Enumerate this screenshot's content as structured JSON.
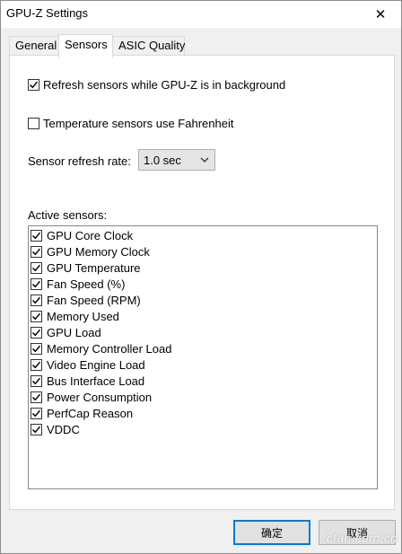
{
  "window": {
    "title": "GPU-Z Settings",
    "close_glyph": "✕"
  },
  "tabs": [
    {
      "label": "General",
      "active": false
    },
    {
      "label": "Sensors",
      "active": true
    },
    {
      "label": "ASIC Quality",
      "active": false
    }
  ],
  "options": {
    "refresh_background": {
      "label": "Refresh sensors while GPU-Z is in background",
      "checked": true
    },
    "fahrenheit": {
      "label": "Temperature sensors use Fahrenheit",
      "checked": false
    },
    "refresh_rate_label": "Sensor refresh rate:",
    "refresh_rate_value": "1.0 sec"
  },
  "active_sensors": {
    "label": "Active sensors:",
    "items": [
      {
        "label": "GPU Core Clock",
        "checked": true
      },
      {
        "label": "GPU Memory Clock",
        "checked": true
      },
      {
        "label": "GPU Temperature",
        "checked": true
      },
      {
        "label": "Fan Speed (%)",
        "checked": true
      },
      {
        "label": "Fan Speed (RPM)",
        "checked": true
      },
      {
        "label": "Memory Used",
        "checked": true
      },
      {
        "label": "GPU Load",
        "checked": true
      },
      {
        "label": "Memory Controller Load",
        "checked": true
      },
      {
        "label": "Video Engine Load",
        "checked": true
      },
      {
        "label": "Bus Interface Load",
        "checked": true
      },
      {
        "label": "Power Consumption",
        "checked": true
      },
      {
        "label": "PerfCap Reason",
        "checked": true
      },
      {
        "label": "VDDC",
        "checked": true
      }
    ]
  },
  "buttons": {
    "ok": "确定",
    "cancel": "取消"
  },
  "watermark": "cfan.com.cn",
  "colors": {
    "accent": "#0078d7",
    "panel": "#ffffff",
    "chrome": "#f0f0f0"
  },
  "icons": {
    "checkbox": "checkmark-icon",
    "dropdown": "chevron-down-icon",
    "close": "close-icon"
  }
}
